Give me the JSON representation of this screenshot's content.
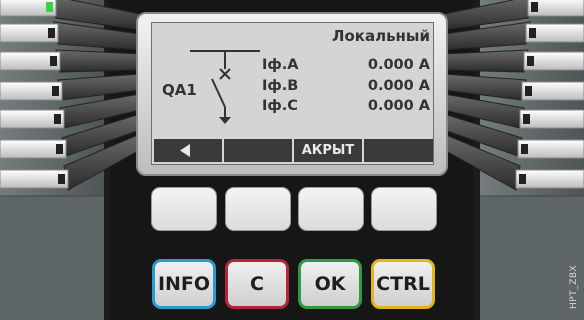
{
  "screen": {
    "title": "Локальный",
    "device_label": "QA1",
    "phases": [
      {
        "name": "Iф.A",
        "value": "0.000 A"
      },
      {
        "name": "Iф.B",
        "value": "0.000 A"
      },
      {
        "name": "Iф.C",
        "value": "0.000 A"
      }
    ],
    "softkeys": [
      "",
      "",
      "АКРЫТ",
      ""
    ]
  },
  "function_keys": [
    {
      "label": "INFO",
      "color": "#2a9ad0"
    },
    {
      "label": "C",
      "color": "#b3263a"
    },
    {
      "label": "OK",
      "color": "#2f9a45"
    },
    {
      "label": "CTRL",
      "color": "#e3b51b"
    }
  ],
  "colors": {
    "panel_dark": "#1c1c1c",
    "side_rails": "#5a6264",
    "lcd_background": "#d4d4d4",
    "status_led": "#39d13f"
  },
  "icons": {
    "softkey_left": "left-triangle-icon",
    "device_symbol": "circuit-breaker-icon"
  },
  "watermark": "HPT_ZBX"
}
